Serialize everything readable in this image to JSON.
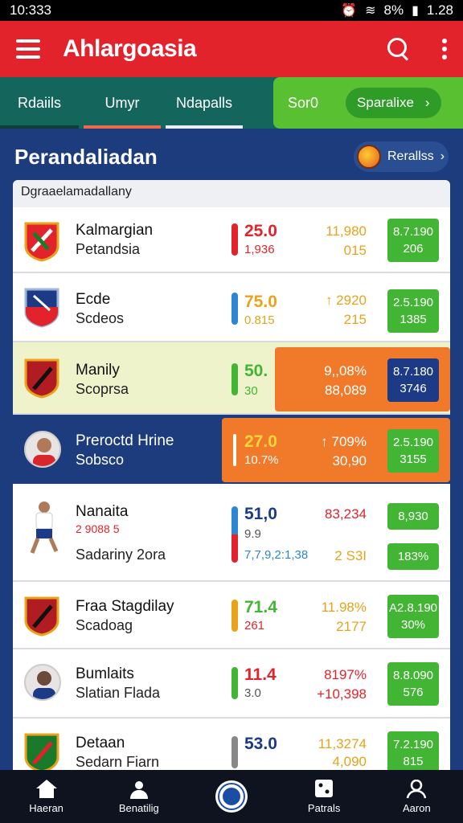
{
  "status": {
    "time": "10:333",
    "battery": "8%",
    "clock_right": "1.28"
  },
  "app": {
    "title": "Ahlargoasia"
  },
  "tabs": [
    {
      "label": "Rdaiils",
      "accent": "#14665c"
    },
    {
      "label": "Umyr",
      "accent": "#ef6a4a"
    },
    {
      "label": "Ndapalls",
      "accent": "#e9eef5"
    }
  ],
  "green_tab": {
    "label": "Sor0",
    "pill_label": "Sparalixe"
  },
  "section": {
    "title": "Perandaliadan",
    "results_label": "Rerallss"
  },
  "subheader": "Dgraaelamadallany",
  "rows": [
    {
      "name": "Kalmargian",
      "sub": "Petandsia",
      "score": "25.0",
      "score_sub": "1,936",
      "stat1": "11,980",
      "stat2": "015",
      "box1": "8.7.190",
      "box2": "206",
      "bar_color": "#e3232b",
      "score_color": "#e3232b"
    },
    {
      "name": "Ecde",
      "sub": "Scdeos",
      "score": "75.0",
      "score_sub": "0.815",
      "stat1": "↑ 2920",
      "stat2": "215",
      "box1": "2.5.190",
      "box2": "1385",
      "bar_color": "#2d86d4",
      "score_color": "#e8a31b"
    },
    {
      "name": "Manily",
      "sub": "Scoprsa",
      "score": "50.",
      "score_sub": "30",
      "stat1": "9,,08%",
      "stat2": "88,089",
      "box1": "8.7.180",
      "box2": "3746",
      "bar_color": "#42b534",
      "score_color": "#42b534"
    },
    {
      "name": "Preroctd Hrine",
      "sub": "Sobsco",
      "score": "27.0",
      "score_sub": "10.7%",
      "stat1": "↑ 709%",
      "stat2": "30,90",
      "box1": "2.5.190",
      "box2": "3155",
      "bar_color": "#ffffff",
      "score_color": "#f7d53a"
    },
    {
      "name": "Nanaita",
      "sub": "Sadariny 2ora",
      "extra": "2 9088 5",
      "score": "51,0",
      "score_sub": "9.9",
      "score_sub2": "7,7,9,2:1,38",
      "stat1": "83,234",
      "stat2": "2 S3I",
      "box1": "8,930",
      "box2": "183%",
      "bar_color": "#2d86d4",
      "score_color": "#1d3a86"
    },
    {
      "name": "Fraa Stagdilay",
      "sub": "Scadoag",
      "score": "71.4",
      "score_sub": "261",
      "stat1": "11.98%",
      "stat2": "2177",
      "box1": "A2.8.190",
      "box2": "30%",
      "bar_color": "#e8a31b",
      "score_color": "#42b534"
    },
    {
      "name": "Bumlaits",
      "sub": "Slatian Flada",
      "score": "11.4",
      "score_sub": "3.0",
      "stat1": "8197%",
      "stat2": "+10,398",
      "box1": "8.8.090",
      "box2": "576",
      "bar_color": "#42b534",
      "score_color": "#e3232b"
    },
    {
      "name": "Detaan",
      "sub": "Sedarn Fiarn",
      "score": "53.0",
      "score_sub": "",
      "stat1": "11,3274",
      "stat2": "4,090",
      "box1": "7.2.190",
      "box2": "815",
      "bar_color": "#888888",
      "score_color": "#1d3a86"
    }
  ],
  "nav": [
    {
      "label": "Haeran",
      "icon": "home-icon"
    },
    {
      "label": "Benatilig",
      "icon": "users-icon"
    },
    {
      "label": "",
      "icon": "center-logo-icon"
    },
    {
      "label": "Patrals",
      "icon": "dice-icon"
    },
    {
      "label": "Aaron",
      "icon": "profile-icon"
    }
  ]
}
